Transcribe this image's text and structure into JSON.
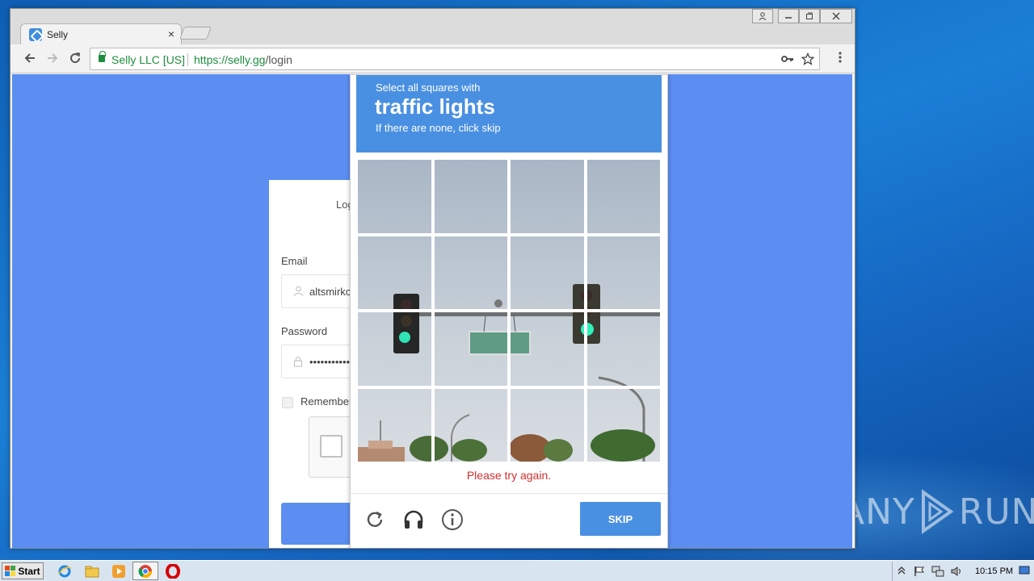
{
  "browser": {
    "tab_title": "Selly",
    "tab_close": "×",
    "site_identity": "Selly LLC [US]",
    "url_scheme_host": "https://selly.gg",
    "url_path": "/login"
  },
  "login": {
    "title_partial": "Log",
    "email_label": "Email",
    "email_value": "altsmirkc",
    "password_label": "Password",
    "password_value": "•••••••••••",
    "remember_label": "Remember"
  },
  "captcha": {
    "instruction": "Select all squares with",
    "object": "traffic lights",
    "hint": "If there are none, click skip",
    "error": "Please try again.",
    "skip_label": "SKIP"
  },
  "taskbar": {
    "start_label": "Start",
    "clock": "10:15 PM"
  },
  "watermark": {
    "left": "ANY",
    "right": "RUN"
  },
  "colors": {
    "page_bg": "#5b8ef0",
    "captcha_blue": "#4a90e2",
    "error_red": "#d32f2f",
    "secure_green": "#1e8e3e"
  }
}
